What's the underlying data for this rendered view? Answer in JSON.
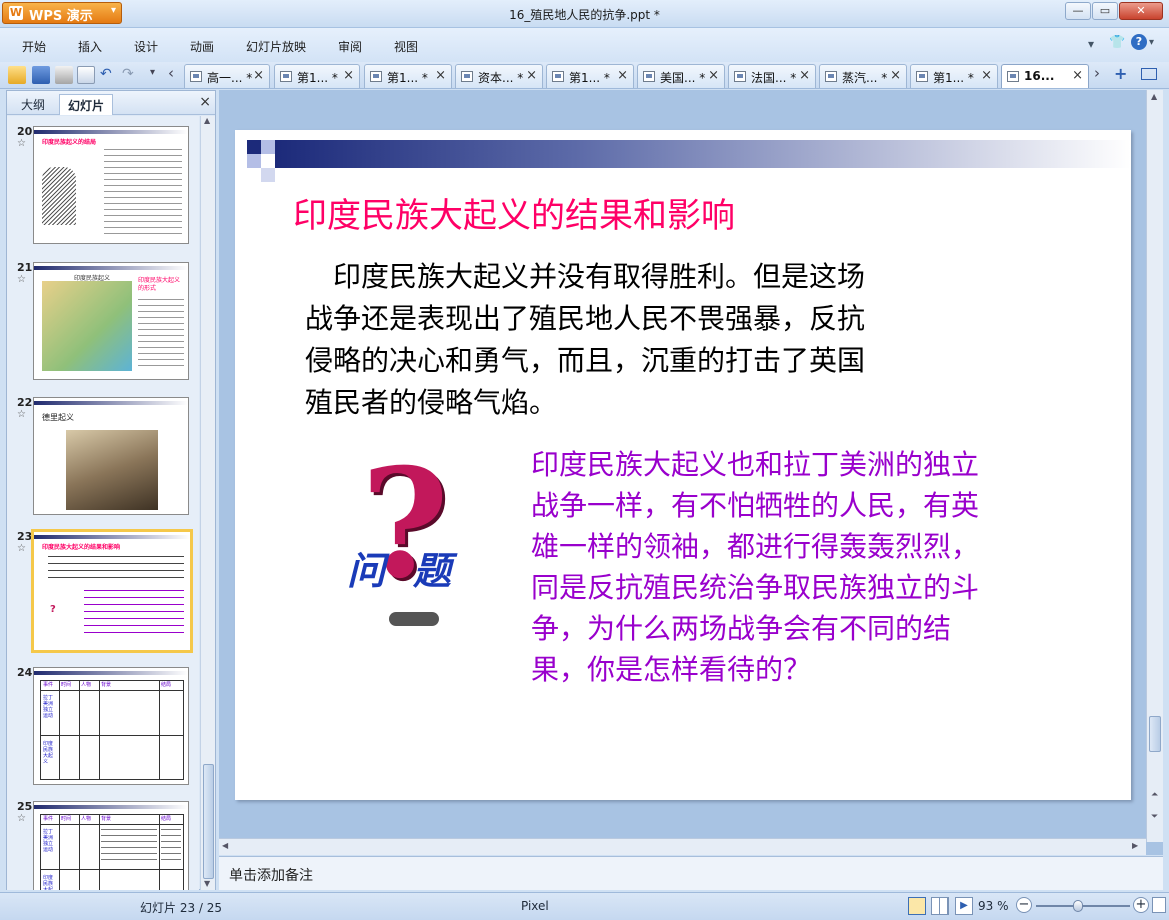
{
  "app": {
    "name": "WPS 演示",
    "doc_title": "16_殖民地人民的抗争.ppt *"
  },
  "menu": [
    "开始",
    "插入",
    "设计",
    "动画",
    "幻灯片放映",
    "审阅",
    "视图"
  ],
  "tabs": [
    {
      "label": "高一... *"
    },
    {
      "label": "第1... *"
    },
    {
      "label": "第1... *"
    },
    {
      "label": "资本... *"
    },
    {
      "label": "第1... *"
    },
    {
      "label": "美国... *"
    },
    {
      "label": "法国... *"
    },
    {
      "label": "蒸汽... *"
    },
    {
      "label": "第1... *"
    },
    {
      "label": "16..."
    }
  ],
  "panel": {
    "tab_outline": "大纲",
    "tab_slides": "幻灯片",
    "close": "×"
  },
  "thumbnails": [
    {
      "num": "20",
      "title": "印度民族起义的结局"
    },
    {
      "num": "21",
      "title": "印度民族起义",
      "side": "印度民族大起义的形式"
    },
    {
      "num": "22",
      "title": "德里起义"
    },
    {
      "num": "23",
      "title": "印度民族大起义的结果和影响"
    },
    {
      "num": "24",
      "headers": [
        "事件",
        "时间",
        "人物",
        "背景",
        "结局"
      ],
      "rows": [
        "拉丁美洲独立运动",
        "印度民族大起义"
      ]
    },
    {
      "num": "25",
      "headers": [
        "事件",
        "时间",
        "人物",
        "背景",
        "结局"
      ],
      "rows": [
        "拉丁美洲独立运动",
        "印度民族大起义"
      ]
    }
  ],
  "slide": {
    "title": "印度民族大起义的结果和影响",
    "body": [
      "　印度民族大起义并没有取得胜利。但是这场",
      "战争还是表现出了殖民地人民不畏强暴，反抗",
      "侵略的决心和勇气，而且，沉重的打击了英国",
      "殖民者的侵略气焰。"
    ],
    "question_label": "问题",
    "question": [
      "印度民族大起义也和拉丁美洲的独立",
      "战争一样，有不怕牺牲的人民，有英",
      "雄一样的领袖，都进行得轰轰烈烈，",
      "同是反抗殖民统治争取民族独立的斗",
      "争，为什么两场战争会有不同的结",
      "果，你是怎样看待的？"
    ]
  },
  "notes_placeholder": "单击添加备注",
  "status": {
    "slide_counter": "幻灯片 23 / 25",
    "theme": "Pixel",
    "zoom": "93 %"
  },
  "colors": {
    "title": "#ff0066",
    "question": "#9900cc",
    "accent": "#e57a12"
  }
}
